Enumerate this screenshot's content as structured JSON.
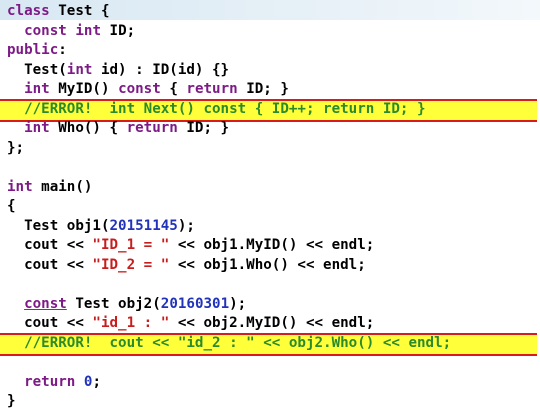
{
  "code": {
    "lines": [
      {
        "parts": [
          {
            "t": "class",
            "c": "kw"
          },
          {
            "t": " Test {",
            "c": ""
          }
        ]
      },
      {
        "parts": [
          {
            "t": "  ",
            "c": ""
          },
          {
            "t": "const",
            "c": "kw"
          },
          {
            "t": " ",
            "c": ""
          },
          {
            "t": "int",
            "c": "kw"
          },
          {
            "t": " ID;",
            "c": ""
          }
        ]
      },
      {
        "parts": [
          {
            "t": "public",
            "c": "kw"
          },
          {
            "t": ":",
            "c": ""
          }
        ]
      },
      {
        "parts": [
          {
            "t": "  Test(",
            "c": ""
          },
          {
            "t": "int",
            "c": "kw"
          },
          {
            "t": " id) : ID(id) {}",
            "c": ""
          }
        ]
      },
      {
        "parts": [
          {
            "t": "  ",
            "c": ""
          },
          {
            "t": "int",
            "c": "kw"
          },
          {
            "t": " MyID() ",
            "c": ""
          },
          {
            "t": "const",
            "c": "kw"
          },
          {
            "t": " { ",
            "c": ""
          },
          {
            "t": "return",
            "c": "kw"
          },
          {
            "t": " ID; }",
            "c": ""
          }
        ]
      },
      {
        "parts": [
          {
            "t": "  //ERROR!  int Next() const { ID++; return ID; }",
            "c": "cm"
          }
        ],
        "highlight": true
      },
      {
        "parts": [
          {
            "t": "  ",
            "c": ""
          },
          {
            "t": "int",
            "c": "kw"
          },
          {
            "t": " Who() { ",
            "c": ""
          },
          {
            "t": "return",
            "c": "kw"
          },
          {
            "t": " ID; }",
            "c": ""
          }
        ]
      },
      {
        "parts": [
          {
            "t": "};",
            "c": ""
          }
        ]
      },
      {
        "parts": []
      },
      {
        "parts": [
          {
            "t": "int",
            "c": "kw"
          },
          {
            "t": " main()",
            "c": ""
          }
        ]
      },
      {
        "parts": [
          {
            "t": "{",
            "c": ""
          }
        ]
      },
      {
        "parts": [
          {
            "t": "  Test obj1(",
            "c": ""
          },
          {
            "t": "20151145",
            "c": "num"
          },
          {
            "t": ");",
            "c": ""
          }
        ]
      },
      {
        "parts": [
          {
            "t": "  cout << ",
            "c": ""
          },
          {
            "t": "\"ID_1 = \"",
            "c": "str"
          },
          {
            "t": " << obj1.MyID() << endl;",
            "c": ""
          }
        ]
      },
      {
        "parts": [
          {
            "t": "  cout << ",
            "c": ""
          },
          {
            "t": "\"ID_2 = \"",
            "c": "str"
          },
          {
            "t": " << obj1.Who() << endl;",
            "c": ""
          }
        ]
      },
      {
        "parts": []
      },
      {
        "parts": [
          {
            "t": "  ",
            "c": ""
          },
          {
            "t": "const",
            "c": "kw ul"
          },
          {
            "t": " Test obj2(",
            "c": ""
          },
          {
            "t": "20160301",
            "c": "num"
          },
          {
            "t": ");",
            "c": ""
          }
        ]
      },
      {
        "parts": [
          {
            "t": "  cout << ",
            "c": ""
          },
          {
            "t": "\"id_1 : \"",
            "c": "str"
          },
          {
            "t": " << obj2.MyID() << endl;",
            "c": ""
          }
        ]
      },
      {
        "parts": [
          {
            "t": "  //ERROR!  cout << \"id_2 : \" << obj2.Who() << endl;",
            "c": "cm"
          }
        ],
        "highlight": true
      },
      {
        "parts": []
      },
      {
        "parts": [
          {
            "t": "  ",
            "c": ""
          },
          {
            "t": "return",
            "c": "kw"
          },
          {
            "t": " ",
            "c": ""
          },
          {
            "t": "0",
            "c": "num"
          },
          {
            "t": ";",
            "c": ""
          }
        ]
      },
      {
        "parts": [
          {
            "t": "}",
            "c": ""
          }
        ]
      }
    ]
  }
}
